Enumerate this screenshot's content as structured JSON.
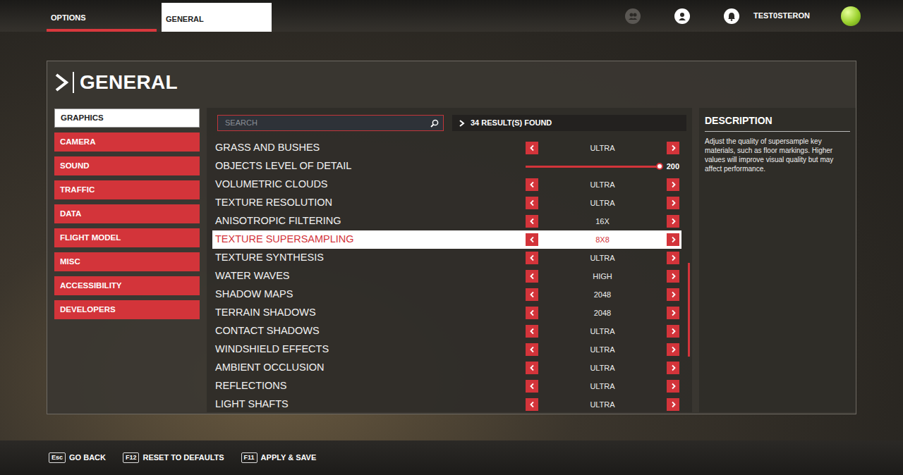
{
  "top_bar": {
    "tabs": [
      {
        "label": "OPTIONS",
        "kind": "underlined"
      },
      {
        "label": "GENERAL",
        "kind": "boxed"
      }
    ],
    "username": "TEST0STERON"
  },
  "panel": {
    "title": "GENERAL"
  },
  "sidebar": {
    "items": [
      {
        "label": "GRAPHICS",
        "selected": true
      },
      {
        "label": "CAMERA",
        "selected": false
      },
      {
        "label": "SOUND",
        "selected": false
      },
      {
        "label": "TRAFFIC",
        "selected": false
      },
      {
        "label": "DATA",
        "selected": false
      },
      {
        "label": "FLIGHT MODEL",
        "selected": false
      },
      {
        "label": "MISC",
        "selected": false
      },
      {
        "label": "ACCESSIBILITY",
        "selected": false
      },
      {
        "label": "DEVELOPERS",
        "selected": false
      }
    ]
  },
  "search": {
    "placeholder": "SEARCH"
  },
  "results": "34 RESULT(S) FOUND",
  "settings": [
    {
      "label": "GRASS AND BUSHES",
      "kind": "choice",
      "value": "ULTRA",
      "selected": false
    },
    {
      "label": "OBJECTS LEVEL OF DETAIL",
      "kind": "slider",
      "value": "200",
      "level": 1.0,
      "selected": false
    },
    {
      "label": "VOLUMETRIC CLOUDS",
      "kind": "choice",
      "value": "ULTRA",
      "selected": false
    },
    {
      "label": "TEXTURE RESOLUTION",
      "kind": "choice",
      "value": "ULTRA",
      "selected": false
    },
    {
      "label": "ANISOTROPIC FILTERING",
      "kind": "choice",
      "value": "16X",
      "selected": false
    },
    {
      "label": "TEXTURE SUPERSAMPLING",
      "kind": "choice",
      "value": "8X8",
      "selected": true
    },
    {
      "label": "TEXTURE SYNTHESIS",
      "kind": "choice",
      "value": "ULTRA",
      "selected": false
    },
    {
      "label": "WATER WAVES",
      "kind": "choice",
      "value": "HIGH",
      "selected": false
    },
    {
      "label": "SHADOW MAPS",
      "kind": "choice",
      "value": "2048",
      "selected": false
    },
    {
      "label": "TERRAIN SHADOWS",
      "kind": "choice",
      "value": "2048",
      "selected": false
    },
    {
      "label": "CONTACT SHADOWS",
      "kind": "choice",
      "value": "ULTRA",
      "selected": false
    },
    {
      "label": "WINDSHIELD EFFECTS",
      "kind": "choice",
      "value": "ULTRA",
      "selected": false
    },
    {
      "label": "AMBIENT OCCLUSION",
      "kind": "choice",
      "value": "ULTRA",
      "selected": false
    },
    {
      "label": "REFLECTIONS",
      "kind": "choice",
      "value": "ULTRA",
      "selected": false
    },
    {
      "label": "LIGHT SHAFTS",
      "kind": "choice",
      "value": "ULTRA",
      "selected": false
    }
  ],
  "scrollbar": {
    "thumb_start": 0.46,
    "thumb_size": 0.35
  },
  "description": {
    "title": "DESCRIPTION",
    "text": "Adjust the quality of supersample key materials, such as floor markings. Higher values will improve visual quality but may affect performance."
  },
  "footer": [
    {
      "key": "Esc",
      "label": "GO BACK"
    },
    {
      "key": "F12",
      "label": "RESET TO DEFAULTS"
    },
    {
      "key": "F11",
      "label": "APPLY & SAVE"
    }
  ]
}
